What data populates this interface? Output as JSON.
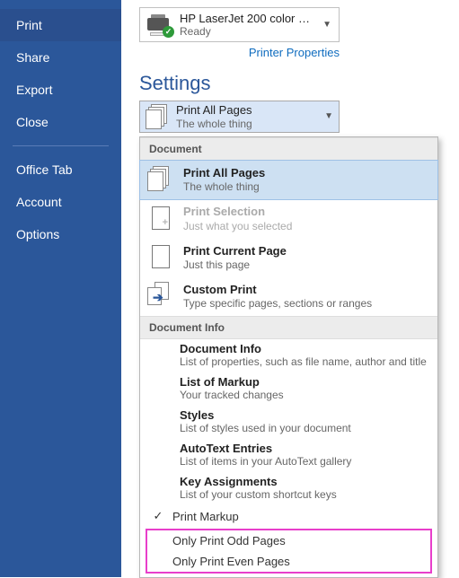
{
  "sidebar": {
    "items": [
      {
        "label": "Print",
        "selected": true
      },
      {
        "label": "Share"
      },
      {
        "label": "Export"
      },
      {
        "label": "Close"
      }
    ],
    "items2": [
      {
        "label": "Office Tab"
      },
      {
        "label": "Account"
      },
      {
        "label": "Options"
      }
    ]
  },
  "printer": {
    "name": "HP LaserJet 200 color MFP...",
    "status": "Ready",
    "properties": "Printer Properties"
  },
  "settings_heading": "Settings",
  "dropdown": {
    "title": "Print All Pages",
    "sub": "The whole thing"
  },
  "menu": {
    "section_document": "Document",
    "doc_items": [
      {
        "title": "Print All Pages",
        "sub": "The whole thing",
        "icon": "stack",
        "hl": true
      },
      {
        "title": "Print Selection",
        "sub": "Just what you selected",
        "icon": "page-plus",
        "disabled": true
      },
      {
        "title": "Print Current Page",
        "sub": "Just this page",
        "icon": "page"
      },
      {
        "title": "Custom Print",
        "sub": "Type specific pages, sections or ranges",
        "icon": "arrow-pages"
      }
    ],
    "section_info": "Document Info",
    "info_items": [
      {
        "title": "Document Info",
        "sub": "List of properties, such as file name, author and title"
      },
      {
        "title": "List of Markup",
        "sub": "Your tracked changes"
      },
      {
        "title": "Styles",
        "sub": "List of styles used in your document"
      },
      {
        "title": "AutoText Entries",
        "sub": "List of items in your AutoText gallery"
      },
      {
        "title": "Key Assignments",
        "sub": "List of your custom shortcut keys"
      }
    ],
    "print_markup": "Print Markup",
    "only_odd": "Only Print Odd Pages",
    "only_even": "Only Print Even Pages"
  }
}
